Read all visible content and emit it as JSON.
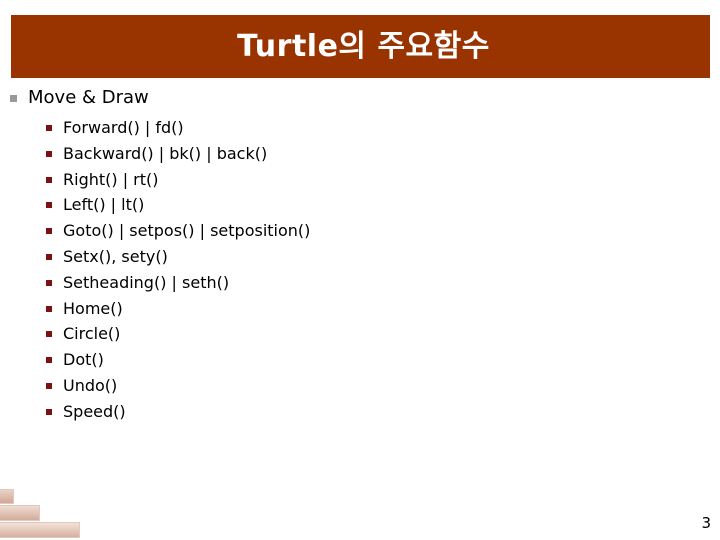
{
  "slide": {
    "title": "Turtle의 주요함수",
    "page_number": "3",
    "banner_color": "#993300",
    "title_color": "#ffffff",
    "level1_bullet_color": "#9a9a9a",
    "level2_bullet_color": "#7b1113",
    "background_color": "#ffffff",
    "decoration_color": "#e0c1b3"
  },
  "section": {
    "heading": "Move & Draw",
    "items": [
      {
        "label": "Forward() | fd()"
      },
      {
        "label": "Backward() | bk() | back()"
      },
      {
        "label": "Right() | rt()"
      },
      {
        "label": "Left() | lt()"
      },
      {
        "label": "Goto() | setpos() | setposition()"
      },
      {
        "label": "Setx(), sety()"
      },
      {
        "label": "Setheading() | seth()"
      },
      {
        "label": "Home()"
      },
      {
        "label": "Circle()"
      },
      {
        "label": "Dot()"
      },
      {
        "label": "Undo()"
      },
      {
        "label": "Speed()"
      }
    ]
  }
}
